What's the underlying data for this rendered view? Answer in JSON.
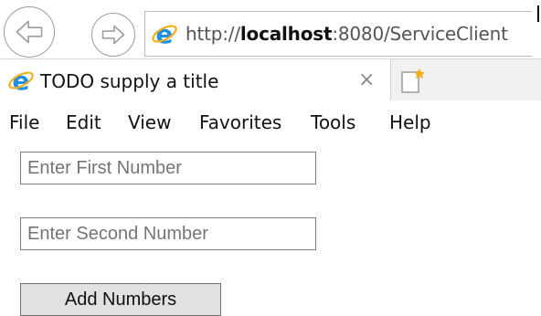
{
  "browser": {
    "address_bar": {
      "url_prefix": "http://",
      "url_host": "localhost",
      "url_suffix": ":8080/ServiceClient"
    },
    "tab": {
      "title": "TODO supply a title",
      "close_glyph": "×"
    },
    "menu": [
      {
        "label": "File"
      },
      {
        "label": "Edit"
      },
      {
        "label": "View"
      },
      {
        "label": "Favorites"
      },
      {
        "label": "Tools"
      },
      {
        "label": "Help"
      }
    ]
  },
  "form": {
    "first_number_placeholder": "Enter First Number",
    "second_number_placeholder": "Enter Second Number",
    "add_button_label": "Add Numbers"
  },
  "icons": {
    "back": "arrow-left-icon",
    "forward": "arrow-right-icon",
    "site": "ie-logo-icon",
    "new_tab": "new-tab-icon"
  },
  "colors": {
    "ie_blue": "#1f8fe3",
    "ie_ring": "#f2b01e",
    "nav_grey": "#9a9a9a",
    "button_bg": "#e1e1e1"
  }
}
